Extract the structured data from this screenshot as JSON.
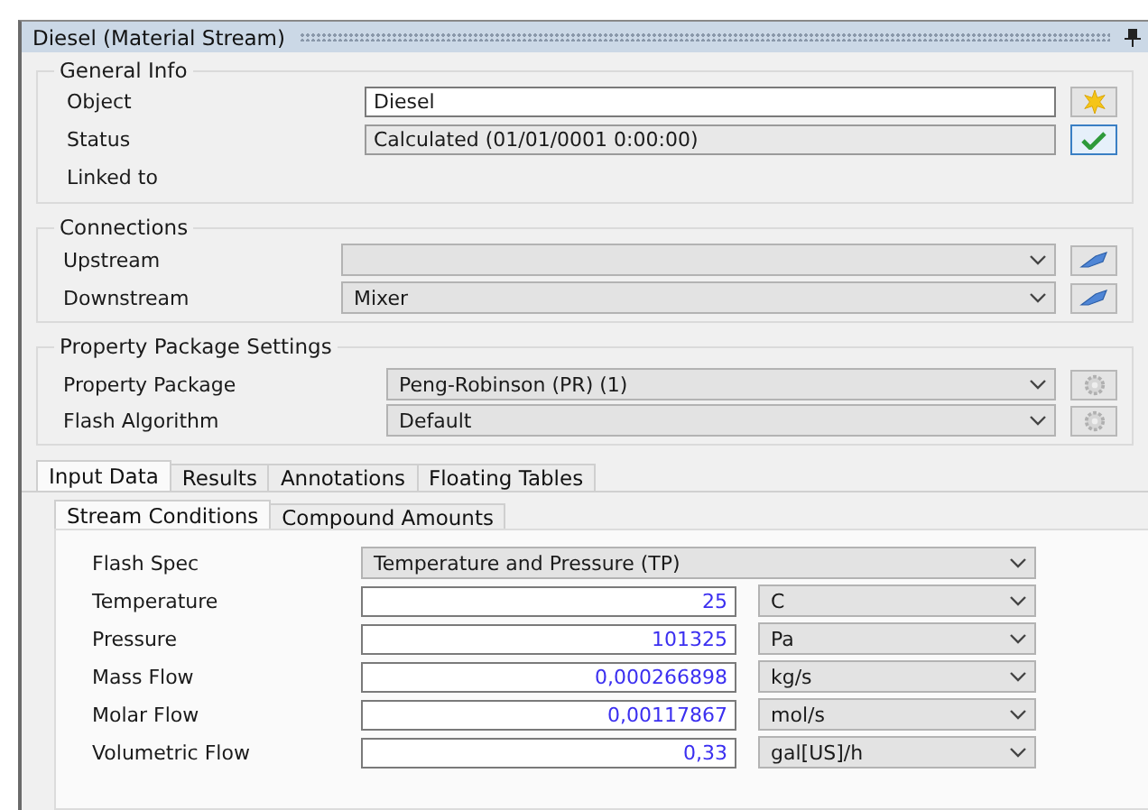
{
  "window": {
    "title": "Diesel (Material Stream)"
  },
  "general_info": {
    "title": "General Info",
    "rows": [
      {
        "label": "Object",
        "kind": "text",
        "value": "Diesel",
        "button": {
          "kind": "star"
        }
      },
      {
        "label": "Status",
        "kind": "readonly",
        "value": "Calculated (01/01/0001 0:00:00)",
        "button": {
          "kind": "check"
        }
      },
      {
        "label": "Linked to",
        "kind": "label"
      }
    ]
  },
  "connections": {
    "title": "Connections",
    "rows": [
      {
        "label": "Upstream",
        "button": {
          "kind": "link"
        }
      },
      {
        "label": "Downstream",
        "value": "Mixer",
        "button": {
          "kind": "link"
        }
      }
    ]
  },
  "property_package": {
    "title": "Property Package Settings",
    "rows": [
      {
        "label": "Property Package",
        "value": "Peng-Robinson (PR) (1)",
        "button": {
          "kind": "gear"
        }
      },
      {
        "label": "Flash Algorithm",
        "value": "Default",
        "button": {
          "kind": "gear"
        }
      }
    ]
  },
  "tabs": [
    {
      "label": "Input Data",
      "selected": true
    },
    {
      "label": "Results",
      "selected": false
    },
    {
      "label": "Annotations",
      "selected": false
    },
    {
      "label": "Floating Tables",
      "selected": false
    }
  ],
  "subtabs": [
    {
      "label": "Stream Conditions",
      "selected": true
    },
    {
      "label": "Compound Amounts",
      "selected": false
    }
  ],
  "stream_conditions": [
    {
      "kind": "combo",
      "label": "Flash Spec",
      "value": "Temperature and Pressure (TP)"
    },
    {
      "kind": "quantity",
      "label": "Temperature",
      "value": "25",
      "unit": "C"
    },
    {
      "kind": "quantity",
      "label": "Pressure",
      "value": "101325",
      "unit": "Pa"
    },
    {
      "kind": "quantity",
      "label": "Mass Flow",
      "value": "0,000266898",
      "unit": "kg/s"
    },
    {
      "kind": "quantity",
      "label": "Molar Flow",
      "value": "0,00117867",
      "unit": "mol/s"
    },
    {
      "kind": "quantity",
      "label": "Volumetric Flow",
      "value": "0,33",
      "unit": "gal[US]/h"
    }
  ]
}
